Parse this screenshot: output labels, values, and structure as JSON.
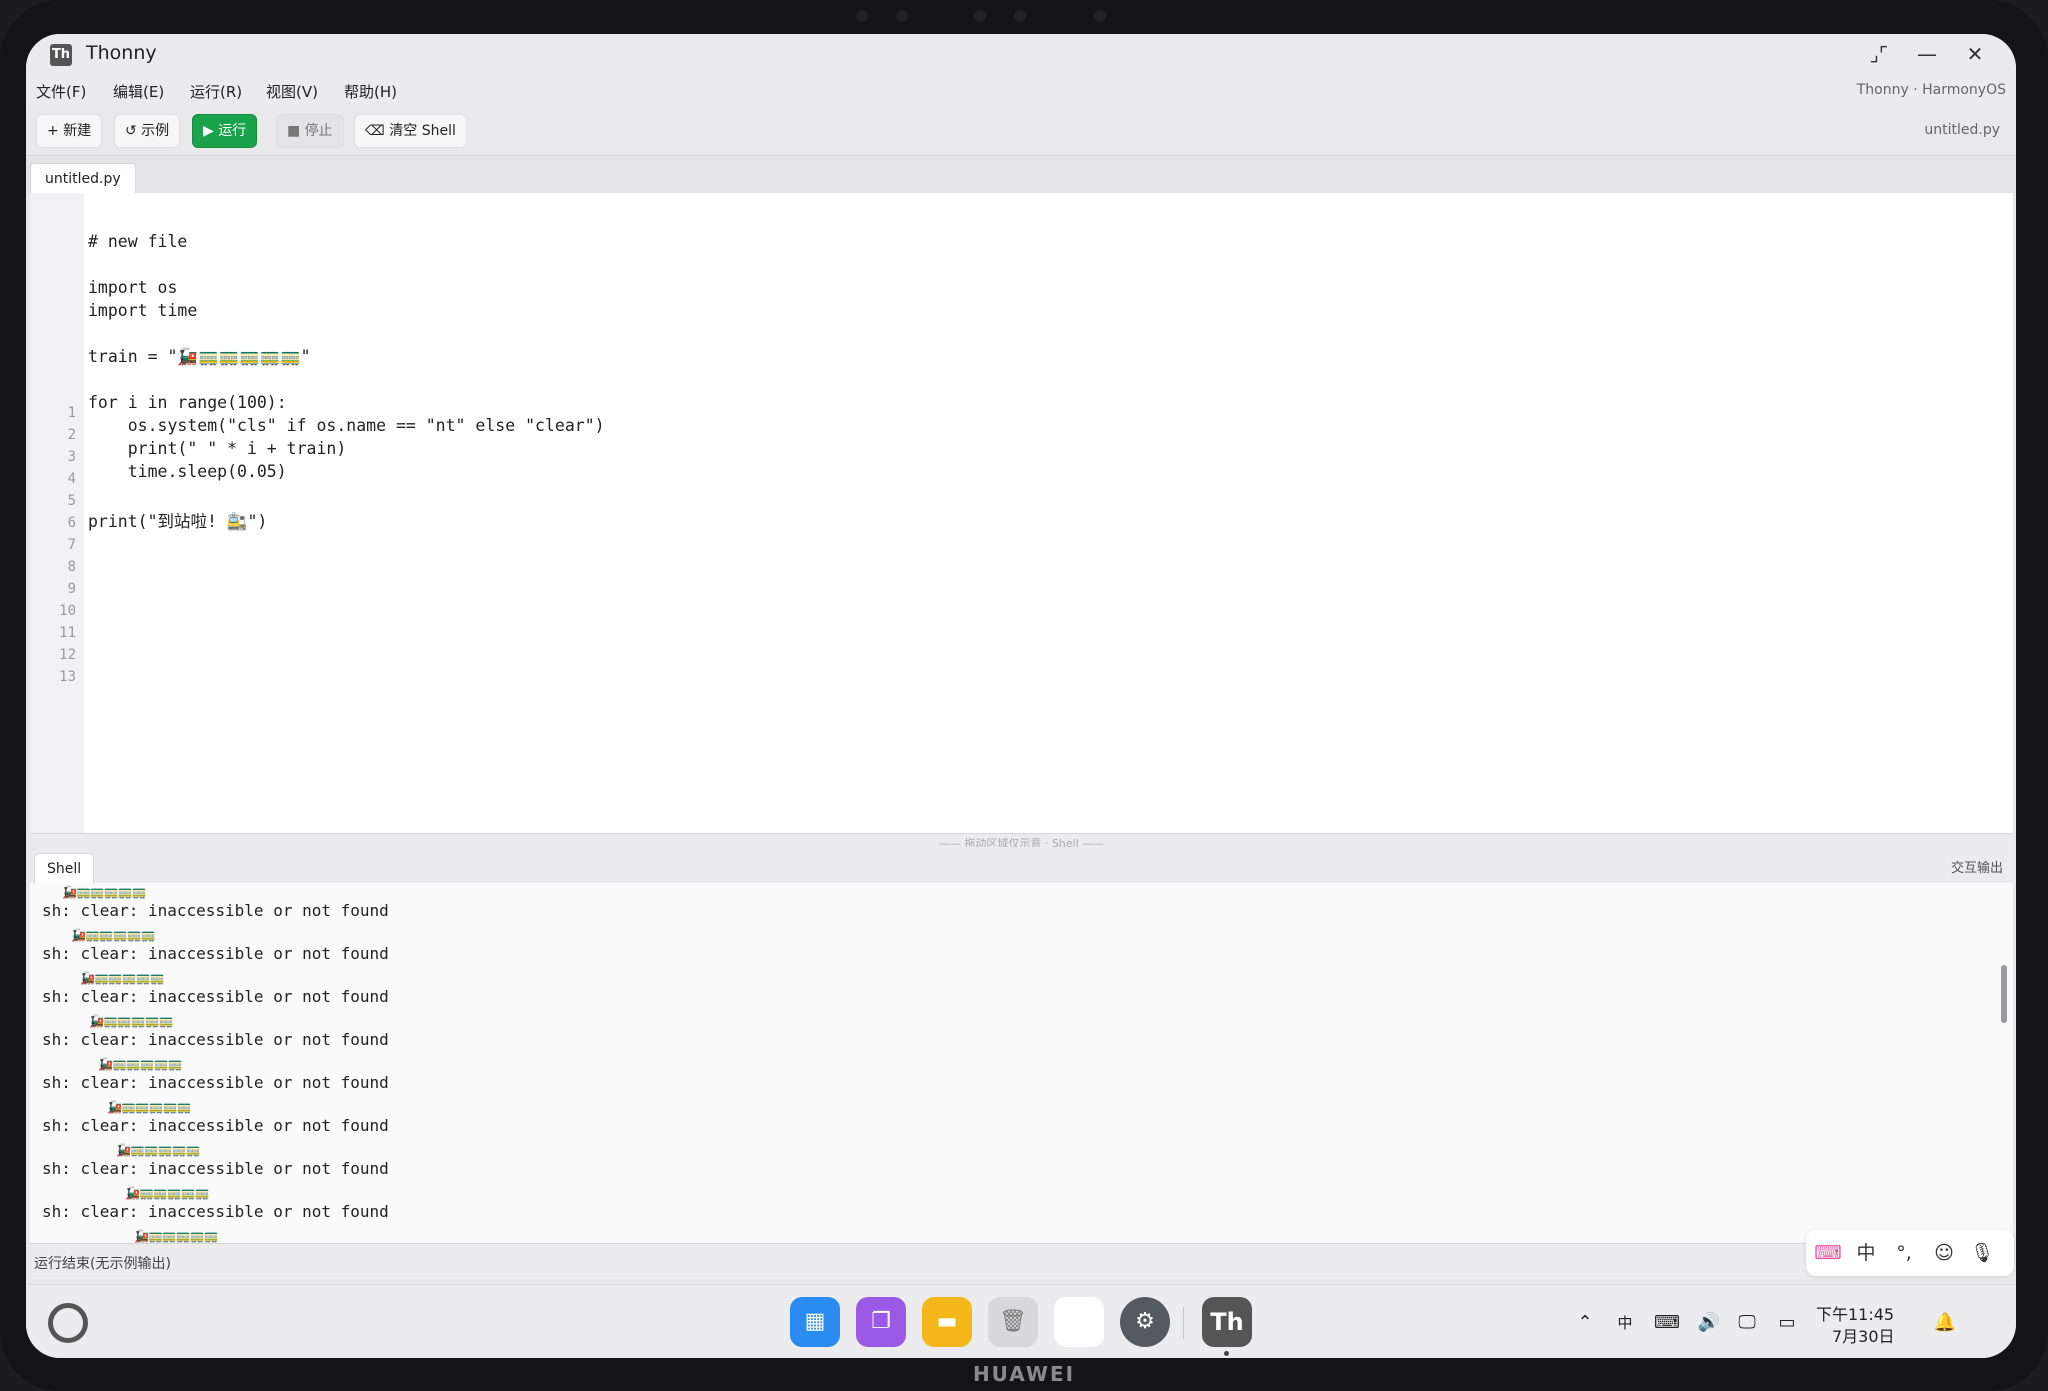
{
  "window": {
    "title": "Thonny",
    "logo": "Th"
  },
  "menu": {
    "items": [
      "文件(F)",
      "编辑(E)",
      "运行(R)",
      "视图(V)",
      "帮助(H)"
    ],
    "right_info": "Thonny · HarmonyOS"
  },
  "toolbar": {
    "new_label": "+ 新建",
    "example_label": "↺ 示例",
    "run_label": "▶ 运行",
    "stop_label": "■ 停止",
    "clear_shell_label": "⌫ 清空 Shell",
    "filename": "untitled.py"
  },
  "editor": {
    "tab_label": "untitled.py",
    "line_numbers": [
      "1",
      "2",
      "3",
      "4",
      "5",
      "6",
      "7",
      "8",
      "9",
      "10",
      "11",
      "12",
      "13"
    ],
    "code_lines": [
      "# new file",
      "",
      "import os",
      "import time",
      "",
      "train = \"🚂🚃🚃🚃🚃🚃\"",
      "",
      "for i in range(100):",
      "    os.system(\"cls\" if os.name == \"nt\" else \"clear\")",
      "    print(\" \" * i + train)",
      "    time.sleep(0.05)",
      "",
      "print(\"到站啦! 🚉\")"
    ]
  },
  "splitter": {
    "label": "—— 拖动区域仅示意 · Shell ——"
  },
  "shell": {
    "tab_label": "Shell",
    "right_label": "交互输出",
    "train": "🚂🚃🚃🚃🚃🚃",
    "error_line": "sh: clear: inaccessible or not found",
    "error_count": 8
  },
  "status": {
    "text": "运行结束(无示例输出)"
  },
  "ime": {
    "items": [
      "中",
      "°,"
    ]
  },
  "taskbar": {
    "tray_lang": "中",
    "time": "下午11:45",
    "date": "7月30日"
  },
  "device": {
    "brand": "HUAWEI"
  },
  "colors": {
    "run_button": "#1aa34a",
    "accent": "#1aa34a"
  }
}
